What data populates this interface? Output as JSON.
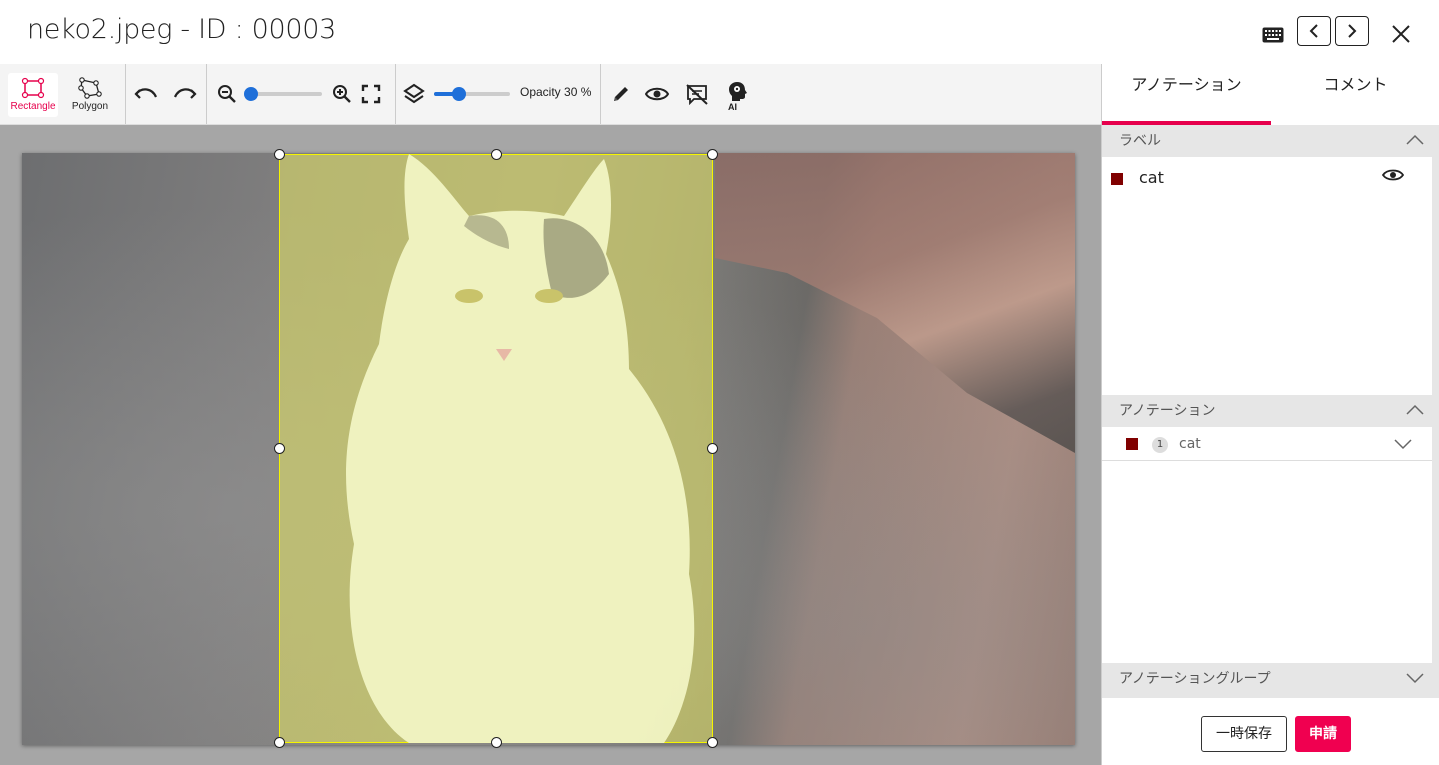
{
  "header": {
    "title": "neko2.jpeg - ID : 00003"
  },
  "toolbar": {
    "rectangle_label": "Rectangle",
    "polygon_label": "Polygon",
    "zoom_level": 0.0,
    "opacity_level": 0.3,
    "opacity_label": "Opacity 30 %",
    "ai_label": "AI"
  },
  "tabs": [
    {
      "label": "アノテーション",
      "active": true
    },
    {
      "label": "コメント",
      "active": false
    }
  ],
  "sections": {
    "labels_title": "ラベル",
    "annotations_title": "アノテーション",
    "groups_title": "アノテーショングループ"
  },
  "labels": [
    {
      "name": "cat",
      "color": "#800000"
    }
  ],
  "annotations": [
    {
      "index": "1",
      "name": "cat",
      "color": "#800000"
    }
  ],
  "footer": {
    "save_label": "一時保存",
    "submit_label": "申請"
  },
  "colors": {
    "accent": "#e6004c",
    "slider": "#1e6fd9",
    "bbox": "#f5f500",
    "label_color": "#800000"
  }
}
